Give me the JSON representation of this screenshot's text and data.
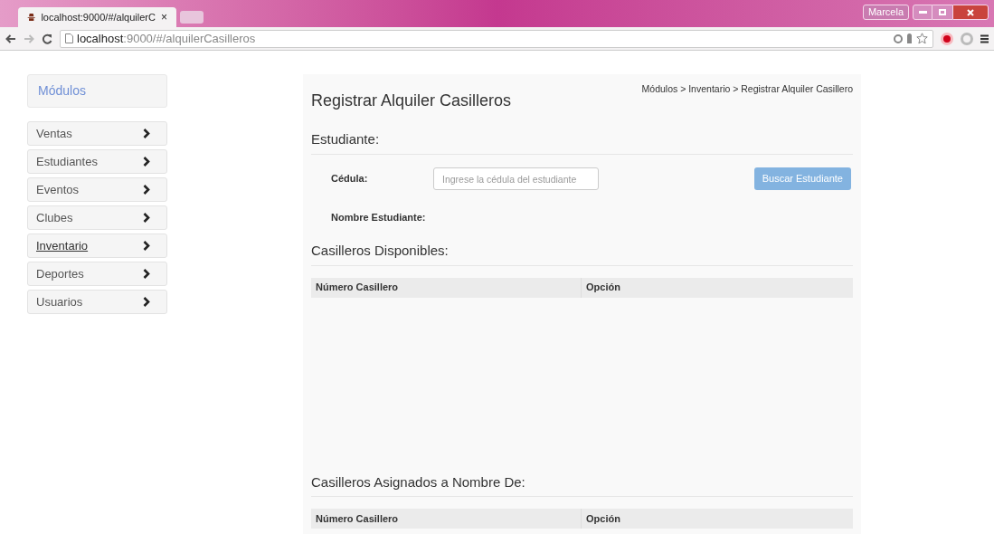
{
  "browser": {
    "tab_title": "localhost:9000/#/alquilerC",
    "tab_close": "×",
    "url_host": "localhost",
    "url_rest": ":9000/#/alquilerCasilleros",
    "profile": "Marcela"
  },
  "sidebar": {
    "title": "Módulos",
    "items": [
      {
        "label": "Ventas",
        "selected": false
      },
      {
        "label": "Estudiantes",
        "selected": false
      },
      {
        "label": "Eventos",
        "selected": false
      },
      {
        "label": "Clubes",
        "selected": false
      },
      {
        "label": "Inventario",
        "selected": true
      },
      {
        "label": "Deportes",
        "selected": false
      },
      {
        "label": "Usuarios",
        "selected": false
      }
    ]
  },
  "page": {
    "title": "Registrar Alquiler Casilleros",
    "breadcrumb": "Módulos > Inventario > Registrar Alquiler Casillero",
    "student_section": "Estudiante:",
    "cedula_label": "Cédula:",
    "cedula_placeholder": "Ingrese la cédula del estudiante",
    "search_button": {
      "label": "Buscar Estudiante",
      "disabled": true
    },
    "name_label": "Nombre Estudiante:",
    "tables": [
      {
        "heading": "Casilleros Disponibles:",
        "columns": [
          "Número Casillero",
          "Opción"
        ]
      },
      {
        "heading": "Casilleros Asignados a Nombre De:",
        "columns": [
          "Número Casillero",
          "Opción"
        ]
      }
    ]
  }
}
